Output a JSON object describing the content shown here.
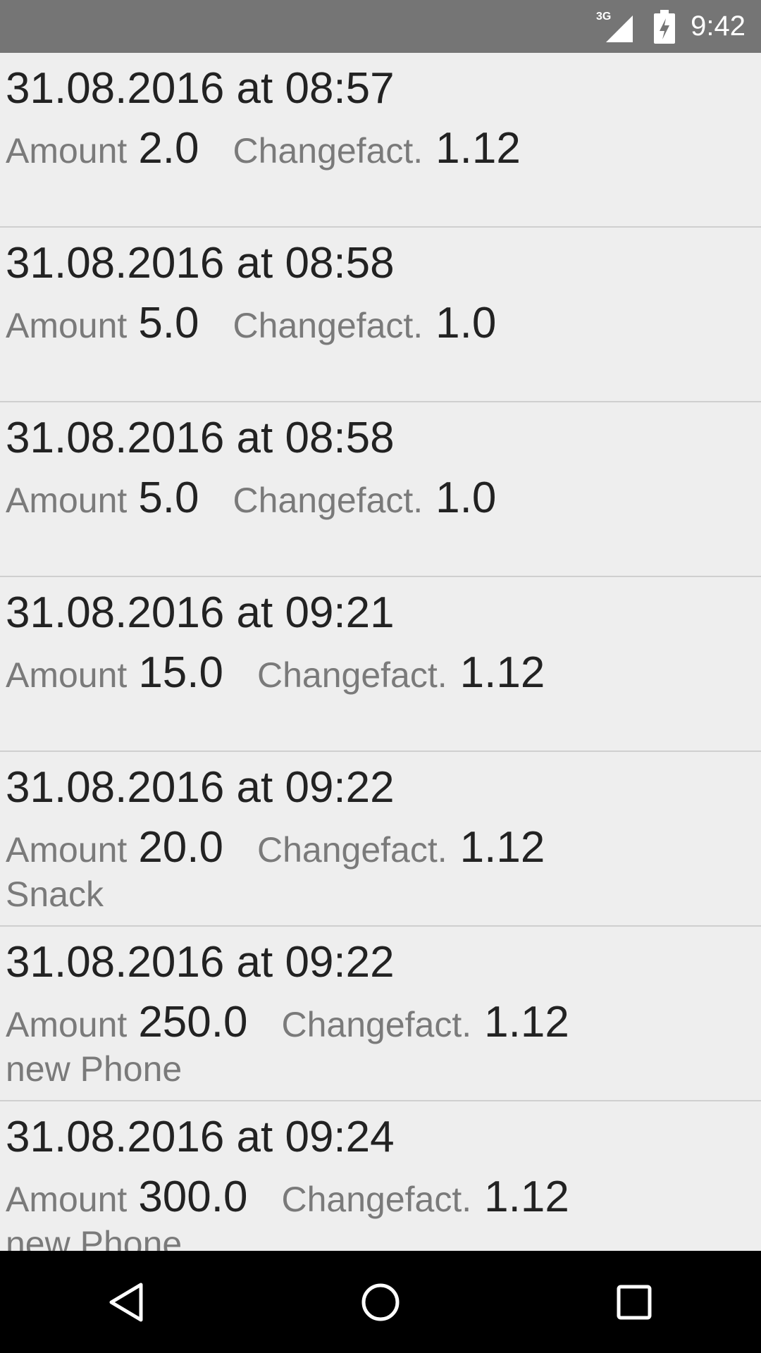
{
  "status_bar": {
    "network": "3G",
    "time": "9:42"
  },
  "labels": {
    "amount": "Amount",
    "changefact": "Changefact."
  },
  "entries": [
    {
      "timestamp": "31.08.2016 at 08:57",
      "amount": "2.0",
      "changefact": "1.12",
      "note": ""
    },
    {
      "timestamp": "31.08.2016 at 08:58",
      "amount": "5.0",
      "changefact": "1.0",
      "note": ""
    },
    {
      "timestamp": "31.08.2016 at 08:58",
      "amount": "5.0",
      "changefact": "1.0",
      "note": ""
    },
    {
      "timestamp": "31.08.2016 at 09:21",
      "amount": "15.0",
      "changefact": "1.12",
      "note": ""
    },
    {
      "timestamp": "31.08.2016 at 09:22",
      "amount": "20.0",
      "changefact": "1.12",
      "note": "Snack"
    },
    {
      "timestamp": "31.08.2016 at 09:22",
      "amount": "250.0",
      "changefact": "1.12",
      "note": "new Phone"
    },
    {
      "timestamp": "31.08.2016 at 09:24",
      "amount": "300.0",
      "changefact": "1.12",
      "note": "new Phone"
    }
  ],
  "icons": {
    "signal": "signal-icon",
    "battery": "battery-charging-icon",
    "back": "back-icon",
    "home": "home-icon",
    "recents": "recents-icon"
  }
}
